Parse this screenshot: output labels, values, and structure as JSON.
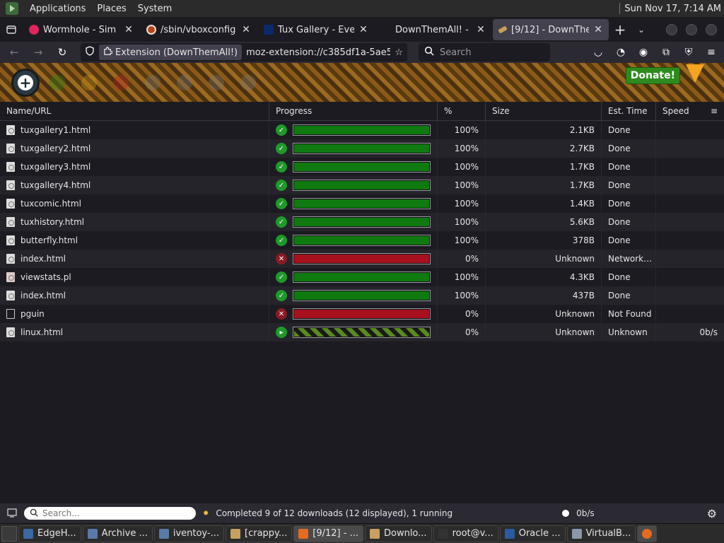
{
  "gnome": {
    "menus": [
      "Applications",
      "Places",
      "System"
    ],
    "clock": "Sun Nov 17,  7:14 AM"
  },
  "tabs": [
    {
      "title": "Wormhole - Sim",
      "icon": "wormhole-icon"
    },
    {
      "title": "/sbin/vboxconfig",
      "icon": "vbox-icon"
    },
    {
      "title": "Tux Gallery - Eve",
      "icon": "tux-icon"
    },
    {
      "title": "DownThemAll! -",
      "icon": "downthemall-icon"
    },
    {
      "title": "[9/12] - DownThe",
      "icon": "downthemall-icon",
      "active": true
    }
  ],
  "navbar": {
    "extension_chip": "Extension (DownThemAll!)",
    "url": "moz-extension://c385df1a-5ae5",
    "search_placeholder": "Search"
  },
  "toolbar": {
    "donate_label": "Donate!"
  },
  "table": {
    "columns": [
      "Name/URL",
      "Progress",
      "%",
      "Size",
      "Est. Time",
      "Speed"
    ],
    "rows": [
      {
        "name": "tuxgallery1.html",
        "pct": "100%",
        "size": "2.1KB",
        "time": "Done",
        "speed": "",
        "status": "done",
        "progress": 1.0,
        "icon": "html-file-icon"
      },
      {
        "name": "tuxgallery2.html",
        "pct": "100%",
        "size": "2.7KB",
        "time": "Done",
        "speed": "",
        "status": "done",
        "progress": 1.0,
        "icon": "html-file-icon"
      },
      {
        "name": "tuxgallery3.html",
        "pct": "100%",
        "size": "1.7KB",
        "time": "Done",
        "speed": "",
        "status": "done",
        "progress": 1.0,
        "icon": "html-file-icon"
      },
      {
        "name": "tuxgallery4.html",
        "pct": "100%",
        "size": "1.7KB",
        "time": "Done",
        "speed": "",
        "status": "done",
        "progress": 1.0,
        "icon": "html-file-icon"
      },
      {
        "name": "tuxcomic.html",
        "pct": "100%",
        "size": "1.4KB",
        "time": "Done",
        "speed": "",
        "status": "done",
        "progress": 1.0,
        "icon": "html-file-icon"
      },
      {
        "name": "tuxhistory.html",
        "pct": "100%",
        "size": "5.6KB",
        "time": "Done",
        "speed": "",
        "status": "done",
        "progress": 1.0,
        "icon": "html-file-icon"
      },
      {
        "name": "butterfly.html",
        "pct": "100%",
        "size": "378B",
        "time": "Done",
        "speed": "",
        "status": "done",
        "progress": 1.0,
        "icon": "html-file-icon"
      },
      {
        "name": "index.html",
        "pct": "0%",
        "size": "Unknown",
        "time": "Network…",
        "speed": "",
        "status": "error",
        "progress": 1.0,
        "icon": "html-file-icon"
      },
      {
        "name": "viewstats.pl",
        "pct": "100%",
        "size": "4.3KB",
        "time": "Done",
        "speed": "",
        "status": "done",
        "progress": 1.0,
        "icon": "script-file-icon"
      },
      {
        "name": "index.html",
        "pct": "100%",
        "size": "437B",
        "time": "Done",
        "speed": "",
        "status": "done",
        "progress": 1.0,
        "icon": "html-file-icon"
      },
      {
        "name": "pguin",
        "pct": "0%",
        "size": "Unknown",
        "time": "Not Found",
        "speed": "",
        "status": "error",
        "progress": 1.0,
        "icon": "blank-file-icon"
      },
      {
        "name": "linux.html",
        "pct": "0%",
        "size": "Unknown",
        "time": "Unknown",
        "speed": "0b/s",
        "status": "running",
        "progress": 1.0,
        "icon": "html-file-icon"
      }
    ]
  },
  "statusbar": {
    "search_placeholder": "Search...",
    "summary": "Completed 9 of 12 downloads (12 displayed), 1 running",
    "speed": "0b/s"
  },
  "taskbar": [
    {
      "label": "EdgeH...",
      "icon": "edge-icon"
    },
    {
      "label": "Archive ...",
      "icon": "archive-icon"
    },
    {
      "label": "iventoy-...",
      "icon": "app-icon"
    },
    {
      "label": "[crappy...",
      "icon": "folder-icon"
    },
    {
      "label": "[9/12] - ...",
      "icon": "firefox-icon",
      "active": true
    },
    {
      "label": "Downlo...",
      "icon": "folder-icon"
    },
    {
      "label": "root@v...",
      "icon": "terminal-icon"
    },
    {
      "label": "Oracle ...",
      "icon": "virtualbox-icon"
    },
    {
      "label": "VirtualB...",
      "icon": "window-icon"
    }
  ],
  "colors": {
    "done": "#0f7a10",
    "error": "#a8101e",
    "running_stripe": "#5a8a1e"
  }
}
